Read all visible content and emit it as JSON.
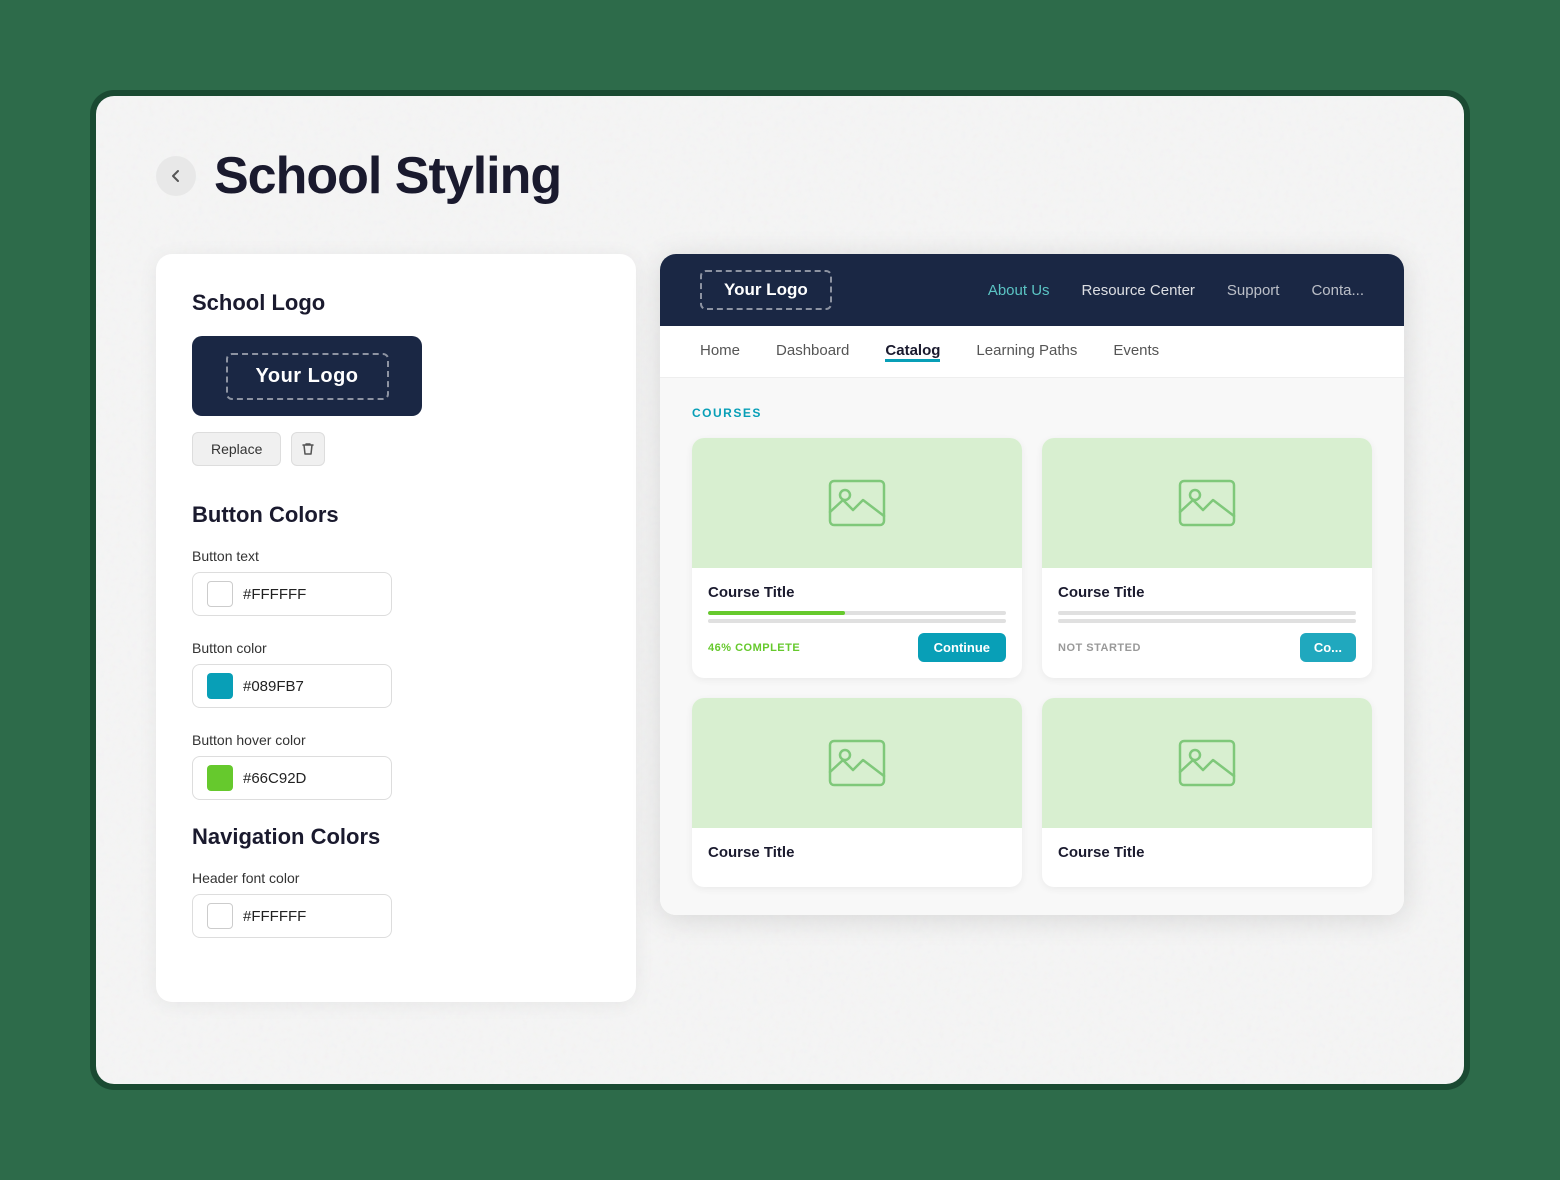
{
  "page": {
    "title": "School Styling",
    "back_label": "←"
  },
  "left_panel": {
    "logo_section": {
      "title": "School Logo",
      "logo_text": "Your Logo",
      "replace_btn": "Replace",
      "delete_icon": "🗑"
    },
    "button_colors": {
      "title": "Button Colors",
      "fields": [
        {
          "label": "Button text",
          "value": "#FFFFFF",
          "color": "#FFFFFF",
          "border": true
        },
        {
          "label": "Button color",
          "value": "#089FB7",
          "color": "#089FB7"
        },
        {
          "label": "Button hover color",
          "value": "#66C92D",
          "color": "#66C92D"
        }
      ]
    },
    "navigation_colors": {
      "title": "Navigation Colors",
      "fields": [
        {
          "label": "Header font color",
          "value": "#FFFFFF",
          "color": "#FFFFFF",
          "border": true
        }
      ]
    }
  },
  "preview": {
    "header": {
      "logo_text": "Your Logo",
      "nav_items": [
        {
          "label": "About Us",
          "active": true
        },
        {
          "label": "Resource Center",
          "active": false
        },
        {
          "label": "Support",
          "active": false
        },
        {
          "label": "Conta...",
          "active": false
        }
      ]
    },
    "subnav": {
      "items": [
        {
          "label": "Home",
          "active": false
        },
        {
          "label": "Dashboard",
          "active": false
        },
        {
          "label": "Catalog",
          "active": true
        },
        {
          "label": "Learning Paths",
          "active": false
        },
        {
          "label": "Events",
          "active": false
        }
      ]
    },
    "courses_section": {
      "label": "COURSES",
      "cards": [
        {
          "title": "Course Title",
          "progress": 46,
          "progress_label": "46% COMPLETE",
          "btn_label": "Continue",
          "show_progress": true
        },
        {
          "title": "Course Title",
          "progress": 0,
          "progress_label": "NOT STARTED",
          "btn_label": "Co...",
          "show_progress": false
        },
        {
          "title": "Course Title",
          "progress": 0,
          "progress_label": "",
          "btn_label": "",
          "show_progress": false
        },
        {
          "title": "Course Title",
          "progress": 0,
          "progress_label": "",
          "btn_label": "",
          "show_progress": false
        }
      ]
    }
  }
}
